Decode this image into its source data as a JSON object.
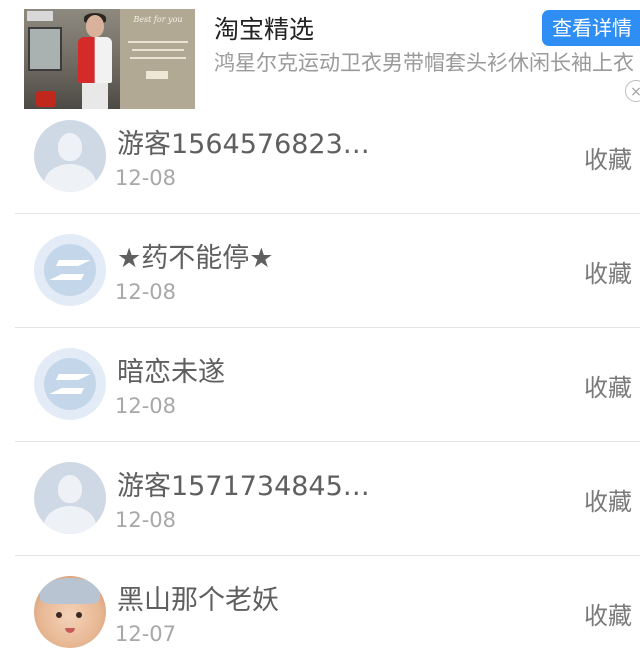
{
  "ad": {
    "title": "淘宝精选",
    "description": "鸿星尔克运动卫衣男带帽套头衫休闲长袖上衣",
    "button_label": "查看详情",
    "close_symbol": "×",
    "image_card_title": "Best for you"
  },
  "list": {
    "items": [
      {
        "avatar": "default-avatar-icon",
        "name": "游客1564576823…",
        "date": "12-08",
        "action": "收藏"
      },
      {
        "avatar": "qq-avatar-icon",
        "name": "★药不能停★",
        "date": "12-08",
        "action": "收藏"
      },
      {
        "avatar": "qq-avatar-icon",
        "name": "暗恋未遂",
        "date": "12-08",
        "action": "收藏"
      },
      {
        "avatar": "default-avatar-icon",
        "name": "游客1571734845…",
        "date": "12-08",
        "action": "收藏"
      },
      {
        "avatar": "baby-photo-avatar",
        "name": "黑山那个老妖",
        "date": "12-07",
        "action": "收藏"
      }
    ]
  },
  "colors": {
    "accent_button": "#2f8ef4",
    "name_text": "#5f5f5f",
    "date_text": "#a8a8a8"
  }
}
